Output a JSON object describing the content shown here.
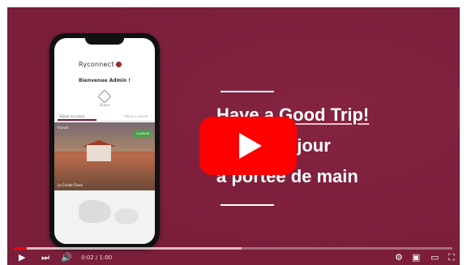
{
  "phone_app": {
    "brand": "Ryconnect",
    "welcome": "Bienvenue Admin !",
    "small_label": "Séjour",
    "tab_active": "Séjour en cours",
    "tab_other": "Séjours passés",
    "hero_tag": "France",
    "hero_badge": "Confirmé",
    "hero_caption": "Le Chalet Fleuri"
  },
  "headline": {
    "line1": "Have a Good Trip!",
    "line2": "éjour",
    "line3": "à portée de main"
  },
  "player": {
    "time": "0:02 / 1:00",
    "progress_fraction": 0.03,
    "buffered_fraction": 0.52,
    "play_icon": "play-icon",
    "accent": "#ff0000",
    "background": "#7a1e3a"
  }
}
